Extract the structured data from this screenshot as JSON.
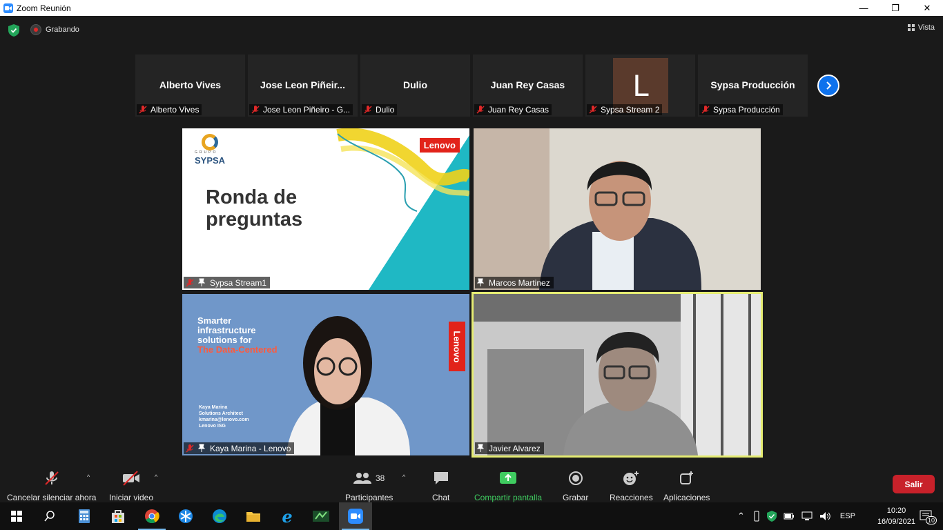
{
  "window": {
    "title": "Zoom Reunión",
    "minimize": "—",
    "maximize": "❐",
    "close": "✕"
  },
  "topbar": {
    "recording": "Grabando",
    "view": "Vista"
  },
  "strip": [
    {
      "name": "Alberto Vives",
      "label": "Alberto Vives"
    },
    {
      "name": "Jose  Leon  Piñeir...",
      "label": "Jose Leon Piñeiro - G..."
    },
    {
      "name": "Dulio",
      "label": "Dulio"
    },
    {
      "name": "Juan Rey Casas",
      "label": "Juan Rey Casas"
    },
    {
      "name": "",
      "avatar": "L",
      "label": "Sypsa Stream 2"
    },
    {
      "name": "Sypsa Producción",
      "label": "Sypsa Producción"
    }
  ],
  "videos": {
    "v1": {
      "label": "Sypsa Stream1",
      "slide_logo_top": "GRUPO",
      "slide_logo": "SYPSA",
      "slide_brand": "Lenovo",
      "slide_title_1": "Ronda de",
      "slide_title_2": "preguntas"
    },
    "v2": {
      "label": "Marcos Martinez"
    },
    "v3": {
      "label": "Kaya Marina - Lenovo",
      "bg_line1": "Smarter",
      "bg_line2": "infrastructure",
      "bg_line3": "solutions for",
      "bg_line4": "The Data-Centered",
      "bg_brand": "Lenovo",
      "card_name": "Kaya Marina",
      "card_role": "Solutions Architect",
      "card_email": "kmarina@lenovo.com",
      "card_org": "Lenovo ISG"
    },
    "v4": {
      "label": "Javier Alvarez"
    }
  },
  "toolbar": {
    "mute": "Cancelar silenciar ahora",
    "video": "Iniciar video",
    "participants": "Participantes",
    "participants_count": "38",
    "chat": "Chat",
    "share": "Compartir pantalla",
    "record": "Grabar",
    "reactions": "Reacciones",
    "apps": "Aplicaciones",
    "leave": "Salir"
  },
  "taskbar": {
    "language": "ESP",
    "time": "10:20",
    "date": "16/09/2021",
    "notifications": "10"
  },
  "colors": {
    "accent_blue": "#0e72ed",
    "share_green": "#3fcc60",
    "leave_red": "#c8212a",
    "active_speaker": "#e5ec73"
  }
}
